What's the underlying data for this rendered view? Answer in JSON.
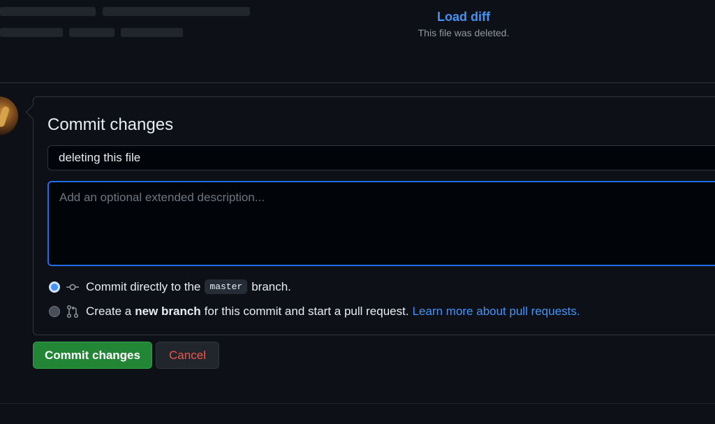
{
  "file_header": {
    "load_diff_label": "Load diff",
    "deleted_note": "This file was deleted."
  },
  "commit_form": {
    "title": "Commit changes",
    "summary_value": "deleting this file",
    "description_placeholder": "Add an optional extended description...",
    "options": [
      {
        "prefix": "Commit directly to the",
        "branch": "master",
        "suffix": "branch.",
        "checked": true,
        "icon": "git-commit-icon"
      },
      {
        "prefix": "Create a",
        "emphasis": "new branch",
        "suffix": "for this commit and start a pull request.",
        "link": "Learn more about pull requests.",
        "checked": false,
        "icon": "git-pull-request-icon"
      }
    ]
  },
  "buttons": {
    "commit_label": "Commit changes",
    "cancel_label": "Cancel"
  },
  "colors": {
    "background": "#0d1117",
    "accent_blue": "#4493f8",
    "primary_green": "#238636",
    "danger_red": "#f85149",
    "border": "#30363d"
  }
}
